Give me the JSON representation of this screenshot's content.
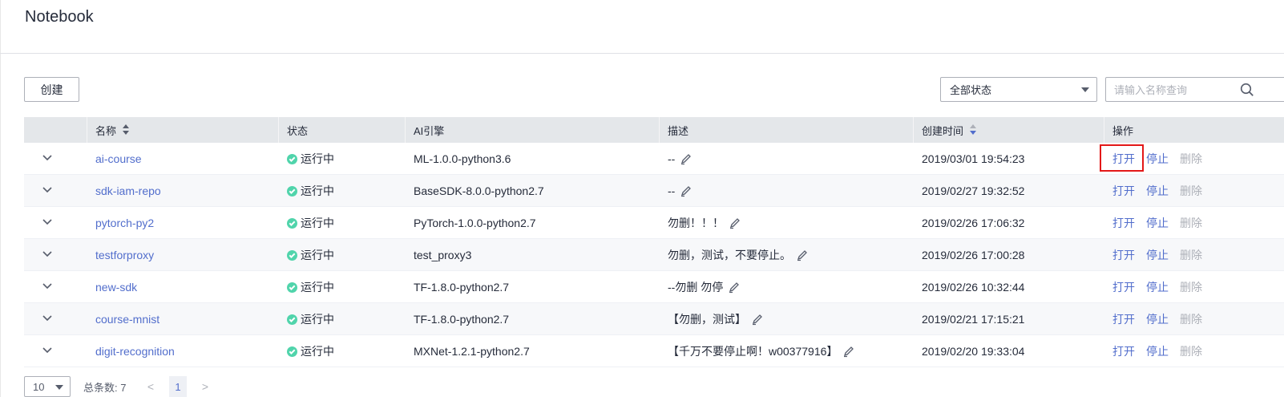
{
  "page": {
    "title": "Notebook"
  },
  "toolbar": {
    "create_label": "创建",
    "status_filter": {
      "selected": "全部状态"
    },
    "search": {
      "placeholder": "请输入名称查询"
    }
  },
  "table": {
    "columns": [
      "名称",
      "状态",
      "AI引擎",
      "描述",
      "创建时间",
      "操作"
    ],
    "rows": [
      {
        "name": "ai-course",
        "status": "运行中",
        "engine": "ML-1.0.0-python3.6",
        "description": "--",
        "created": "2019/03/01 19:54:23"
      },
      {
        "name": "sdk-iam-repo",
        "status": "运行中",
        "engine": "BaseSDK-8.0.0-python2.7",
        "description": "--",
        "created": "2019/02/27 19:32:52"
      },
      {
        "name": "pytorch-py2",
        "status": "运行中",
        "engine": "PyTorch-1.0.0-python2.7",
        "description": "勿删！！！",
        "created": "2019/02/26 17:06:32"
      },
      {
        "name": "testforproxy",
        "status": "运行中",
        "engine": "test_proxy3",
        "description": "勿删，测试，不要停止。",
        "created": "2019/02/26 17:00:28"
      },
      {
        "name": "new-sdk",
        "status": "运行中",
        "engine": "TF-1.8.0-python2.7",
        "description": "--勿删 勿停",
        "created": "2019/02/26 10:32:44"
      },
      {
        "name": "course-mnist",
        "status": "运行中",
        "engine": "TF-1.8.0-python2.7",
        "description": "【勿删，测试】",
        "created": "2019/02/21 17:15:21"
      },
      {
        "name": "digit-recognition",
        "status": "运行中",
        "engine": "MXNet-1.2.1-python2.7",
        "description": "【千万不要停止啊！w00377916】",
        "created": "2019/02/20 19:33:04"
      }
    ],
    "actions": {
      "open": "打开",
      "stop": "停止",
      "delete": "删除"
    }
  },
  "pagination": {
    "page_size": "10",
    "total": "总条数: 7",
    "current_page": "1",
    "prev": "<",
    "next": ">"
  },
  "colors": {
    "link": "#526ecc",
    "running": "#50d4ab",
    "highlight": "#e31818",
    "header_bg": "#e4e7ea",
    "disabled": "#adb0b8"
  }
}
